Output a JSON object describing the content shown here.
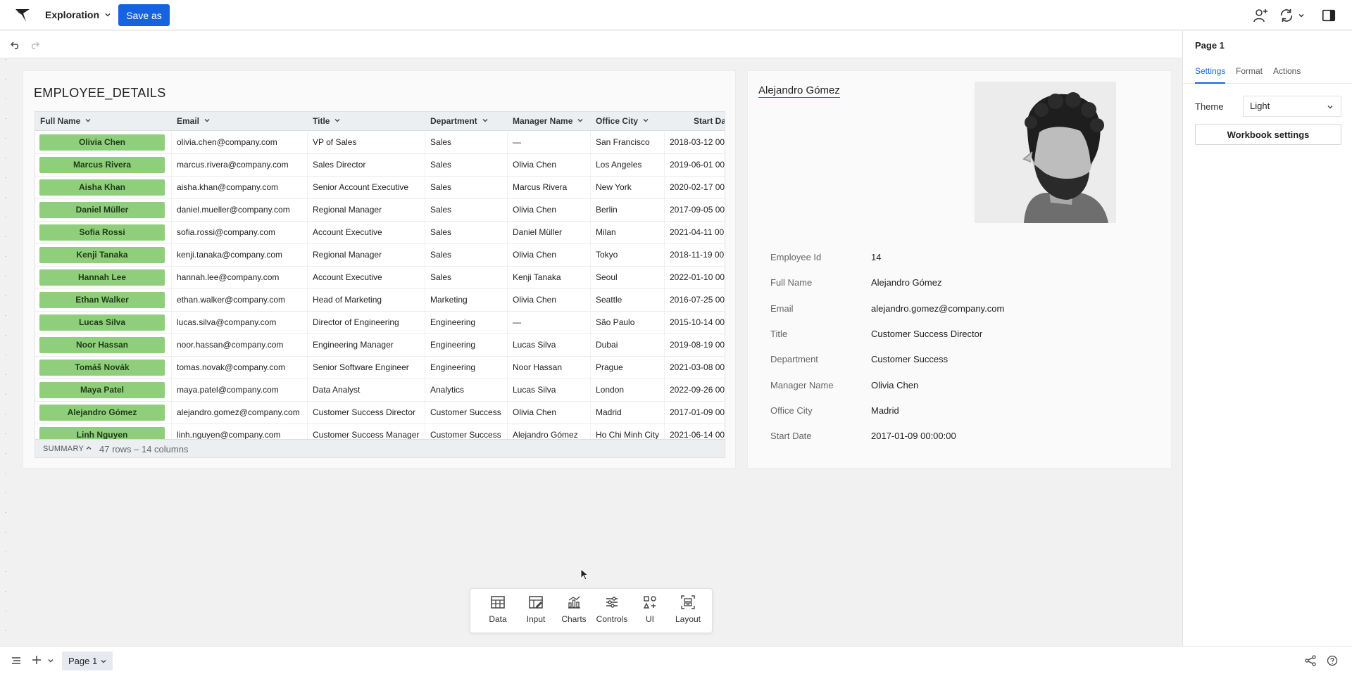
{
  "topbar": {
    "workspace_name": "Exploration",
    "save_as_label": "Save as"
  },
  "table": {
    "title": "EMPLOYEE_DETAILS",
    "columns": [
      "Full Name",
      "Email",
      "Title",
      "Department",
      "Manager Name",
      "Office City",
      "Start Da"
    ],
    "rows": [
      [
        "Olivia Chen",
        "olivia.chen@company.com",
        "VP of Sales",
        "Sales",
        "—",
        "San Francisco",
        "2018-03-12 00:"
      ],
      [
        "Marcus Rivera",
        "marcus.rivera@company.com",
        "Sales Director",
        "Sales",
        "Olivia Chen",
        "Los Angeles",
        "2019-06-01 00:"
      ],
      [
        "Aisha Khan",
        "aisha.khan@company.com",
        "Senior Account Executive",
        "Sales",
        "Marcus Rivera",
        "New York",
        "2020-02-17 00:"
      ],
      [
        "Daniel Müller",
        "daniel.mueller@company.com",
        "Regional Manager",
        "Sales",
        "Olivia Chen",
        "Berlin",
        "2017-09-05 00:"
      ],
      [
        "Sofia Rossi",
        "sofia.rossi@company.com",
        "Account Executive",
        "Sales",
        "Daniel Müller",
        "Milan",
        "2021-04-11 00:"
      ],
      [
        "Kenji Tanaka",
        "kenji.tanaka@company.com",
        "Regional Manager",
        "Sales",
        "Olivia Chen",
        "Tokyo",
        "2018-11-19 00:"
      ],
      [
        "Hannah Lee",
        "hannah.lee@company.com",
        "Account Executive",
        "Sales",
        "Kenji Tanaka",
        "Seoul",
        "2022-01-10 00:"
      ],
      [
        "Ethan Walker",
        "ethan.walker@company.com",
        "Head of Marketing",
        "Marketing",
        "Olivia Chen",
        "Seattle",
        "2016-07-25 00:"
      ],
      [
        "Lucas Silva",
        "lucas.silva@company.com",
        "Director of Engineering",
        "Engineering",
        "—",
        "São Paulo",
        "2015-10-14 00:"
      ],
      [
        "Noor Hassan",
        "noor.hassan@company.com",
        "Engineering Manager",
        "Engineering",
        "Lucas Silva",
        "Dubai",
        "2019-08-19 00:"
      ],
      [
        "Tomáš Novák",
        "tomas.novak@company.com",
        "Senior Software Engineer",
        "Engineering",
        "Noor Hassan",
        "Prague",
        "2021-03-08 00:"
      ],
      [
        "Maya Patel",
        "maya.patel@company.com",
        "Data Analyst",
        "Analytics",
        "Lucas Silva",
        "London",
        "2022-09-26 00:"
      ],
      [
        "Alejandro Gómez",
        "alejandro.gomez@company.com",
        "Customer Success Director",
        "Customer Success",
        "Olivia Chen",
        "Madrid",
        "2017-01-09 00:"
      ],
      [
        "Linh Nguyen",
        "linh.nguyen@company.com",
        "Customer Success Manager",
        "Customer Success",
        "Alejandro Gómez",
        "Ho Chi Minh City",
        "2021-06-14 00:"
      ]
    ],
    "summary_label": "SUMMARY",
    "summary_count": "47 rows – 14 columns"
  },
  "detail": {
    "name": "Alejandro Gómez",
    "fields": [
      {
        "label": "Employee Id",
        "value": "14"
      },
      {
        "label": "Full Name",
        "value": "Alejandro Gómez"
      },
      {
        "label": "Email",
        "value": "alejandro.gomez@company.com"
      },
      {
        "label": "Title",
        "value": "Customer Success Director"
      },
      {
        "label": "Department",
        "value": "Customer Success"
      },
      {
        "label": "Manager Name",
        "value": "Olivia Chen"
      },
      {
        "label": "Office City",
        "value": "Madrid"
      },
      {
        "label": "Start Date",
        "value": "2017-01-09 00:00:00"
      }
    ]
  },
  "dock": {
    "items": [
      "Data",
      "Input",
      "Charts",
      "Controls",
      "UI",
      "Layout"
    ]
  },
  "right_panel": {
    "title": "Page 1",
    "tabs": [
      "Settings",
      "Format",
      "Actions"
    ],
    "theme_label": "Theme",
    "theme_value": "Light",
    "workbook_settings_label": "Workbook settings"
  },
  "bottom_bar": {
    "page_tab_label": "Page 1"
  },
  "colors": {
    "accent": "#1663e0",
    "name_pill": "#8fcf7c"
  }
}
